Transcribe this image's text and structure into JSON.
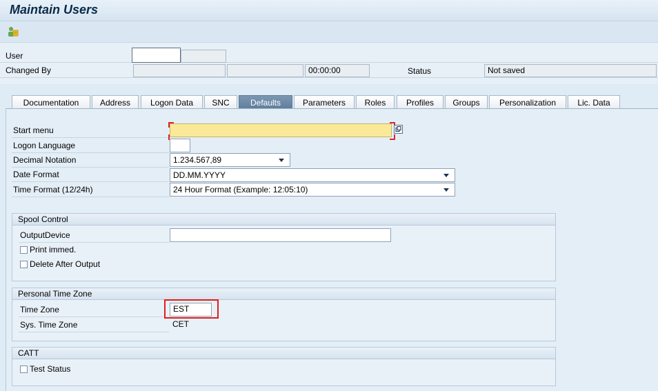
{
  "window": {
    "title": "Maintain Users"
  },
  "toolbar": {
    "icon": "user-edit-icon"
  },
  "header": {
    "user_label": "User",
    "user_value": "",
    "changed_by_label": "Changed By",
    "changed_by_value": "",
    "changed_by_date": "",
    "changed_by_time": "00:00:00",
    "status_label": "Status",
    "status_value": "Not saved"
  },
  "tabs": [
    {
      "label": "Documentation"
    },
    {
      "label": "Address"
    },
    {
      "label": "Logon Data"
    },
    {
      "label": "SNC"
    },
    {
      "label": "Defaults",
      "active": true
    },
    {
      "label": "Parameters"
    },
    {
      "label": "Roles"
    },
    {
      "label": "Profiles"
    },
    {
      "label": "Groups"
    },
    {
      "label": "Personalization"
    },
    {
      "label": "Lic. Data"
    }
  ],
  "defaults": {
    "start_menu_label": "Start menu",
    "start_menu_value": "",
    "logon_language_label": "Logon Language",
    "logon_language_value": "",
    "decimal_notation_label": "Decimal Notation",
    "decimal_notation_value": "1.234.567,89",
    "date_format_label": "Date Format",
    "date_format_value": "DD.MM.YYYY",
    "time_format_label": "Time Format (12/24h)",
    "time_format_value": "24 Hour Format (Example: 12:05:10)"
  },
  "spool": {
    "title": "Spool Control",
    "output_device_label": "OutputDevice",
    "output_device_value": "",
    "print_immed_label": "Print immed.",
    "delete_after_output_label": "Delete After Output"
  },
  "timezone": {
    "title": "Personal Time Zone",
    "time_zone_label": "Time Zone",
    "time_zone_value": "EST",
    "sys_time_zone_label": "Sys. Time Zone",
    "sys_time_zone_value": "CET"
  },
  "catt": {
    "title": "CATT",
    "test_status_label": "Test Status"
  }
}
